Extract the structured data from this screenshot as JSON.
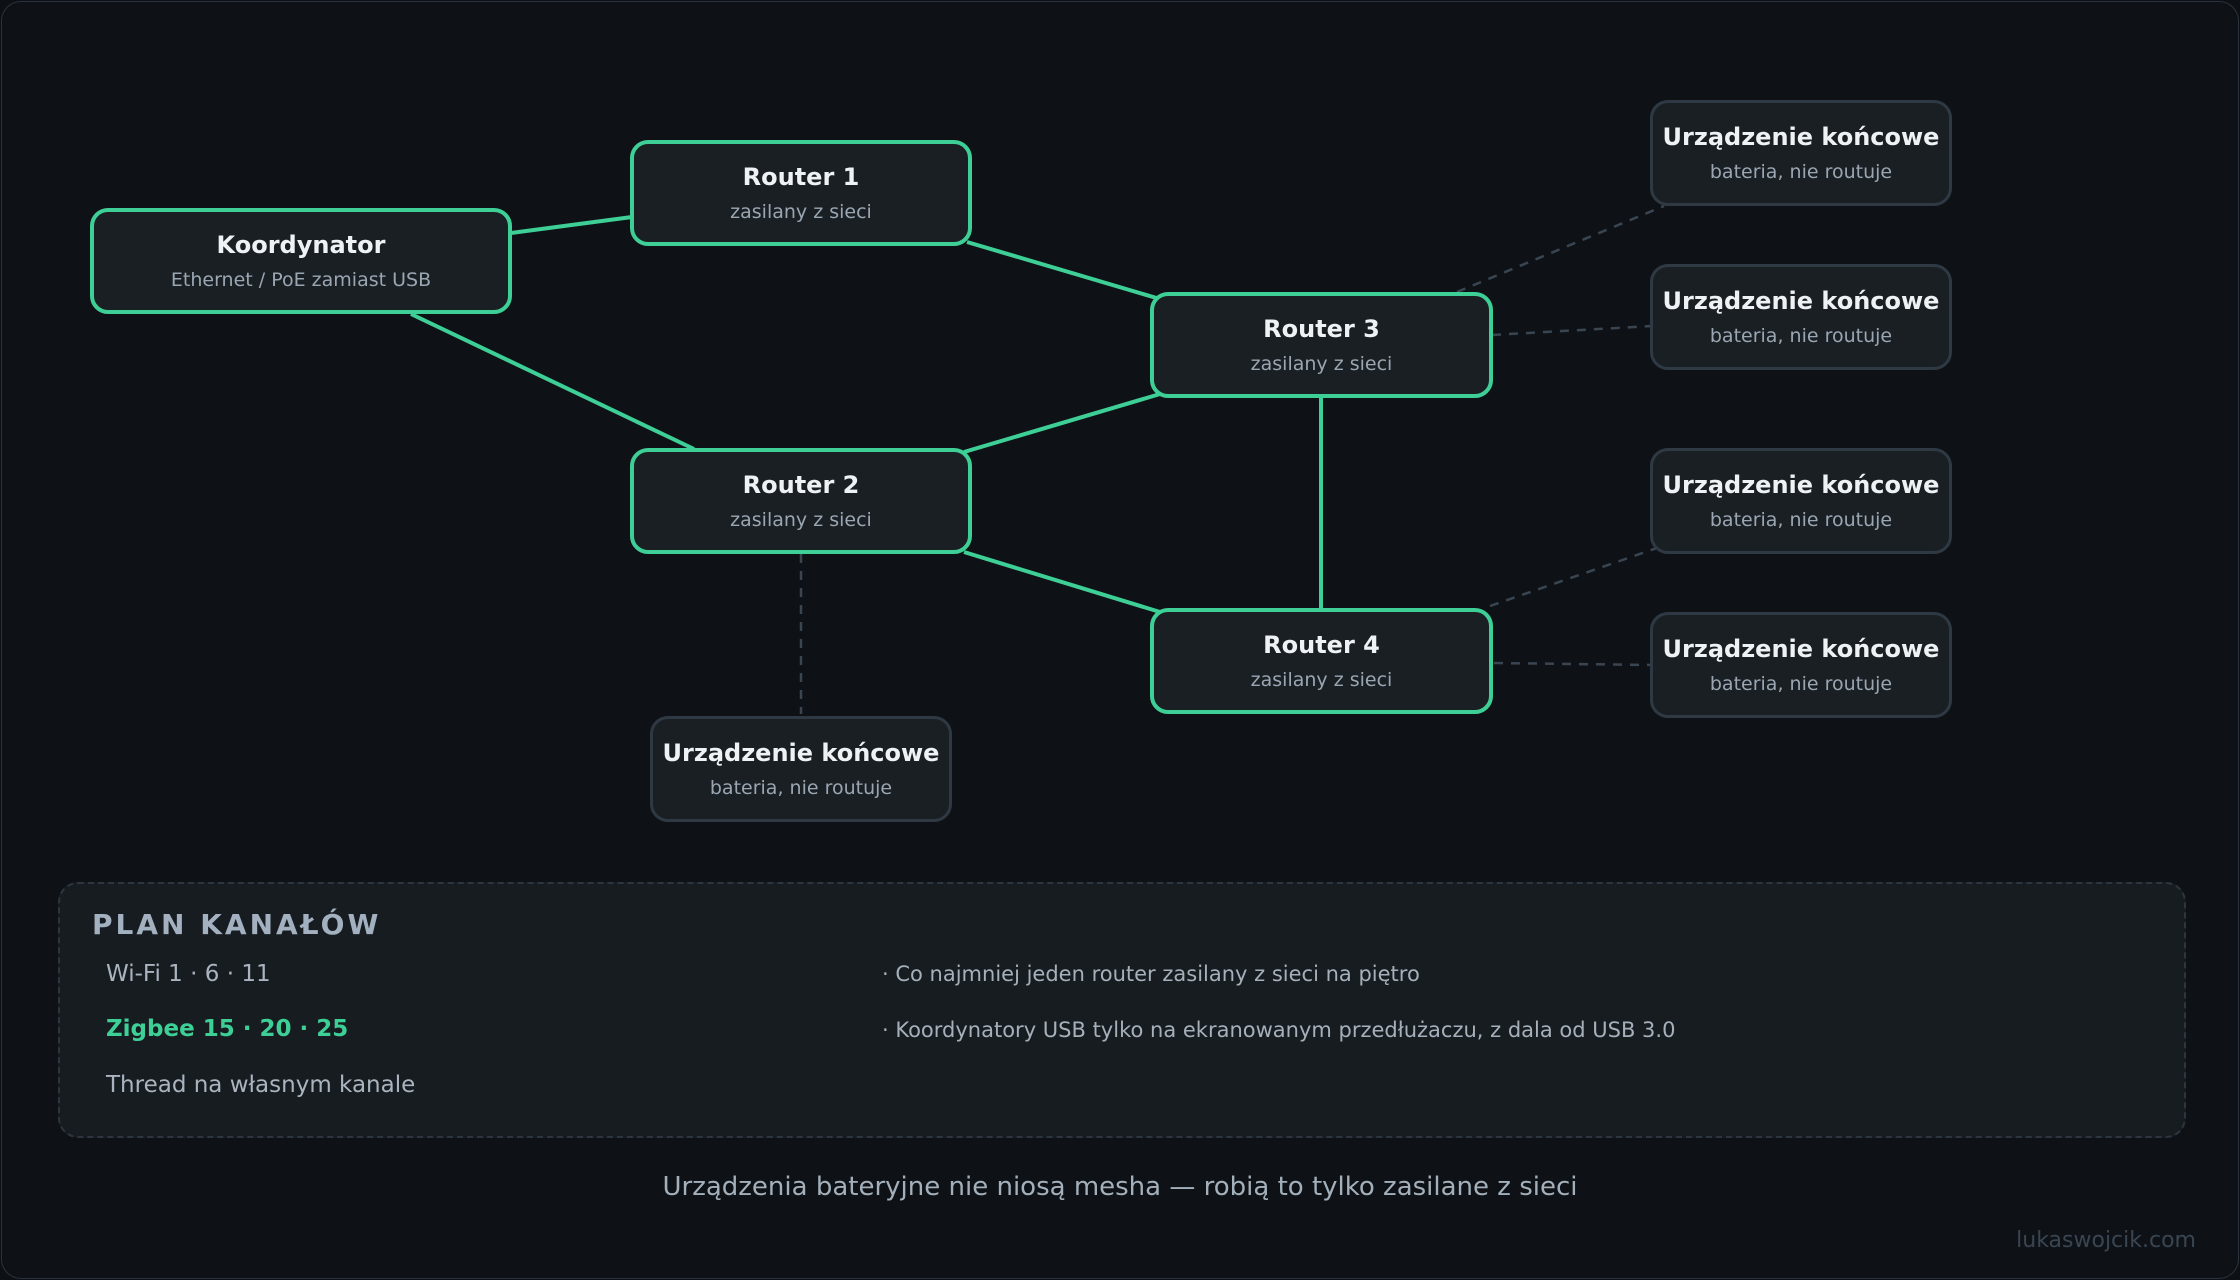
{
  "diagram": {
    "nodes": {
      "coordinator": {
        "title": "Koordynator",
        "subtitle": "Ethernet / PoE zamiast USB"
      },
      "router1": {
        "title": "Router 1",
        "subtitle": "zasilany z sieci"
      },
      "router2": {
        "title": "Router 2",
        "subtitle": "zasilany z sieci"
      },
      "router3": {
        "title": "Router 3",
        "subtitle": "zasilany z sieci"
      },
      "router4": {
        "title": "Router 4",
        "subtitle": "zasilany z sieci"
      },
      "end_devices": [
        {
          "title": "Urządzenie końcowe",
          "subtitle": "bateria, nie routuje"
        },
        {
          "title": "Urządzenie końcowe",
          "subtitle": "bateria, nie routuje"
        },
        {
          "title": "Urządzenie końcowe",
          "subtitle": "bateria, nie routuje"
        },
        {
          "title": "Urządzenie końcowe",
          "subtitle": "bateria, nie routuje"
        },
        {
          "title": "Urządzenie końcowe",
          "subtitle": "bateria, nie routuje"
        }
      ]
    },
    "mesh_links": [
      [
        "coordinator",
        "router1"
      ],
      [
        "coordinator",
        "router2"
      ],
      [
        "router1",
        "router3"
      ],
      [
        "router2",
        "router3"
      ],
      [
        "router2",
        "router4"
      ],
      [
        "router3",
        "router4"
      ]
    ],
    "end_device_links": [
      [
        "router3",
        "end1"
      ],
      [
        "router3",
        "end2"
      ],
      [
        "router4",
        "end3"
      ],
      [
        "router4",
        "end4"
      ],
      [
        "router2",
        "end5"
      ]
    ],
    "colors": {
      "mesh_link": "#3ecf97",
      "end_device_link": "#3a4552",
      "router_border": "#3ecf97",
      "end_device_border": "#2f3944"
    }
  },
  "channel_plan": {
    "title": "PLAN KANAŁÓW",
    "channels": [
      "Wi-Fi 1 · 6 · 11",
      "Zigbee 15 · 20 · 25",
      "Thread na własnym kanale"
    ],
    "notes": [
      "· Co najmniej jeden router zasilany z sieci na piętro",
      "· Koordynatory USB tylko na ekranowanym przedłużaczu, z dala od USB 3.0"
    ]
  },
  "footer": {
    "caption": "Urządzenia bateryjne nie niosą mesha — robią to tylko zasilane z sieci",
    "credit": "lukaswojcik.com"
  }
}
